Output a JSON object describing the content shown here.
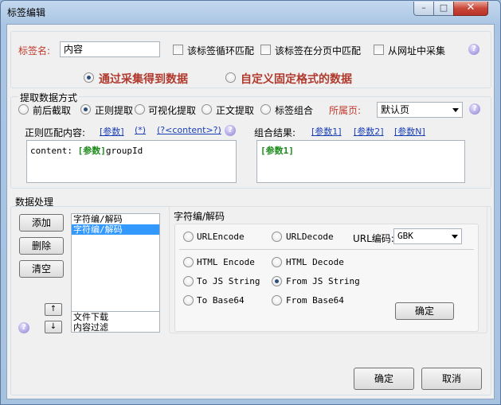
{
  "window": {
    "title": "标签编辑",
    "min_glyph": "–",
    "max_glyph": "□",
    "close_glyph": "✕"
  },
  "tag": {
    "label": "标签名:",
    "value": "内容",
    "loop_match": "该标签循环匹配",
    "paging_match": "该标签在分页中匹配",
    "from_url": "从网址中采集"
  },
  "mode": {
    "collect": "通过采集得到数据",
    "custom": "自定义固定格式的数据"
  },
  "extract": {
    "group_title": "提取数据方式",
    "options": [
      "前后截取",
      "正则提取",
      "可视化提取",
      "正文提取",
      "标签组合"
    ],
    "selected_index": 1,
    "page_label": "所属页:",
    "page_value": "默认页",
    "regex_label": "正则匹配内容:",
    "param_link": "[参数]",
    "star_link": "(*)",
    "content_link": "(?<content>?)",
    "regex_prefix": "content: ",
    "regex_param": "[参数]",
    "regex_suffix": "groupId",
    "result_label": "组合结果:",
    "result_links": [
      "[参数1]",
      "[参数2]",
      "[参数N]"
    ],
    "result_value": "[参数1]"
  },
  "processing": {
    "group_title": "数据处理",
    "add": "添加",
    "delete": "删除",
    "clear": "清空",
    "up": "↑",
    "down": "↓",
    "list_top": [
      "字符编/解码",
      "字符编/解码"
    ],
    "list_bottom": [
      "文件下载",
      "内容过滤"
    ],
    "selected_index": 1
  },
  "encode": {
    "title": "字符编/解码",
    "urlencode": "URLEncode",
    "urldecode": "URLDecode",
    "url_charset_label": "URL编码:",
    "url_charset_value": "GBK",
    "html_encode": "HTML Encode",
    "html_decode": "HTML Decode",
    "to_js": "To JS String",
    "from_js": "From JS String",
    "to_b64": "To Base64",
    "from_b64": "From Base64",
    "confirm": "确定"
  },
  "footer": {
    "ok": "确定",
    "cancel": "取消"
  },
  "help_glyph": "?"
}
